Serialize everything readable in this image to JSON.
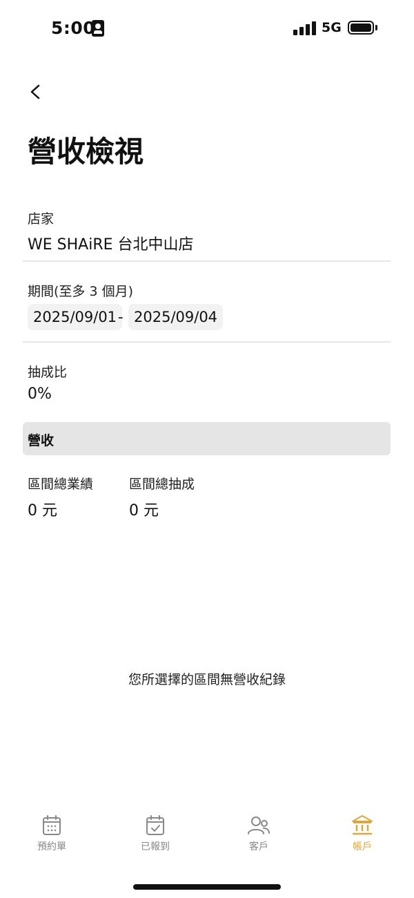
{
  "status_bar": {
    "time": "5:00",
    "network": "5G"
  },
  "header": {
    "title": "營收檢視"
  },
  "store": {
    "label": "店家",
    "value": "WE SHAiRE 台北中山店"
  },
  "period": {
    "label": "期間(至多 3 個月)",
    "start_date": "2025/09/01",
    "separator": "-",
    "end_date": "2025/09/04"
  },
  "commission_rate": {
    "label": "抽成比",
    "value": "0%"
  },
  "revenue": {
    "section_title": "營收",
    "total_sales_label": "區間總業績",
    "total_sales_value": "0 元",
    "total_commission_label": "區間總抽成",
    "total_commission_value": "0 元",
    "empty_message": "您所選擇的區間無營收紀錄"
  },
  "tabs": [
    {
      "label": "預約單",
      "icon": "calendar-icon",
      "active": false
    },
    {
      "label": "已報到",
      "icon": "calendar-check-icon",
      "active": false
    },
    {
      "label": "客戶",
      "icon": "users-icon",
      "active": false
    },
    {
      "label": "帳戶",
      "icon": "bank-icon",
      "active": true
    }
  ],
  "colors": {
    "accent": "#d9a740",
    "inactive_tab": "#888888",
    "section_bg": "#e5e5e5",
    "chip_bg": "#f2f2f2"
  }
}
